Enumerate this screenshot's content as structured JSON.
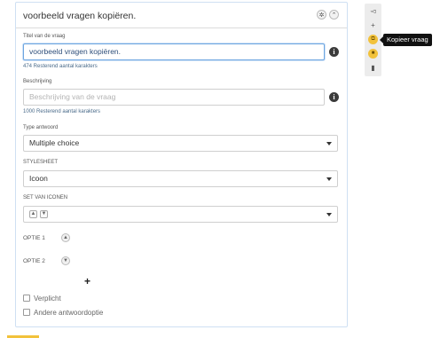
{
  "question": {
    "header_title": "voorbeeld vragen kopiëren.",
    "title_label": "Titel van de vraag",
    "title_value": "voorbeeld vragen kopiëren.",
    "title_remaining": "474 Resterend aantal karakters",
    "description_label": "Beschrijving",
    "description_placeholder": "Beschrijving van de vraag",
    "description_remaining": "1000 Resterend aantal karakters",
    "type_label": "Type antwoord",
    "type_value": "Multiple choice",
    "stylesheet_label": "STYLESHEET",
    "stylesheet_value": "Icoon",
    "iconset_label": "SET VAN ICONEN",
    "options": [
      {
        "label": "OPTIE 1",
        "icon": "thumbs-up-icon"
      },
      {
        "label": "OPTIE 2",
        "icon": "thumbs-down-icon"
      }
    ],
    "add_option": "+",
    "required_label": "Verplicht",
    "other_answer_label": "Andere antwoordoptie"
  },
  "sidebar": {
    "tooltip": "Kopieer vraag",
    "icons": [
      "megaphone-icon",
      "add-icon",
      "copy-icon",
      "lock-icon",
      "trash-icon"
    ]
  },
  "colors": {
    "accent": "#f2c23b",
    "border_active": "#6ea6e0",
    "card_border": "#cfe0f3"
  }
}
